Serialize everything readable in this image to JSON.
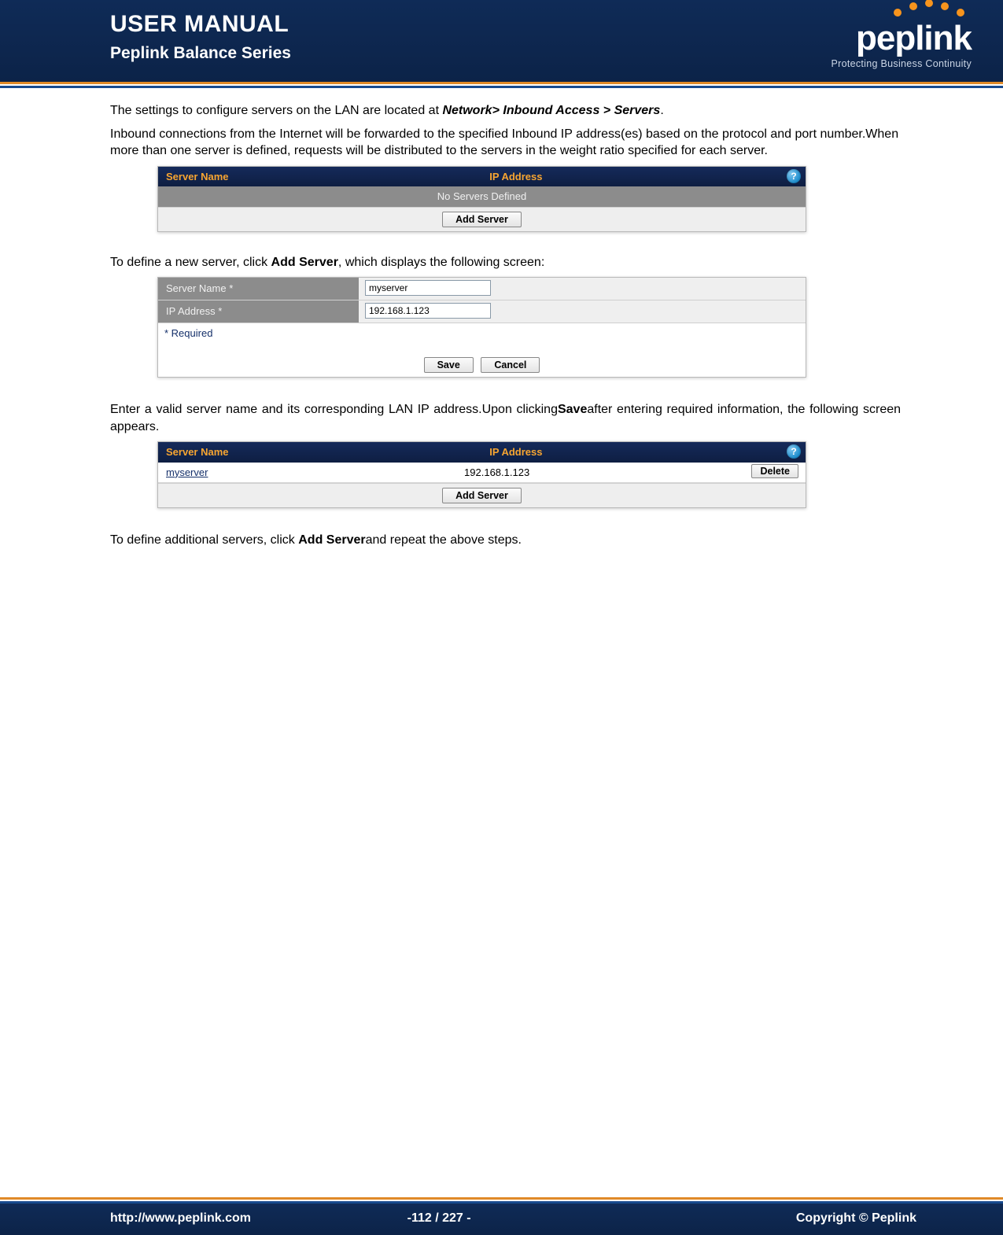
{
  "header": {
    "title": "USER MANUAL",
    "subtitle": "Peplink Balance Series",
    "logo_name": "peplink",
    "logo_tag": "Protecting Business Continuity"
  },
  "body": {
    "p1_pre": "The settings to configure servers on the LAN are located at ",
    "p1_path": "Network> Inbound Access > Servers",
    "p1_post": ".",
    "p2": "Inbound connections from the Internet will be forwarded to the specified Inbound IP address(es) based on the protocol and port number.When more than one server is defined, requests will be distributed to the servers in the weight ratio specified for each server.",
    "p3_pre": "To define a new server, click ",
    "p3_bold": "Add Server",
    "p3_post": ", which displays the following screen:",
    "p4_a": "Enter a valid server name and its corresponding LAN IP address.Upon clicking",
    "p4_b": "Save",
    "p4_c": "after entering required information, the following screen appears.",
    "p5_pre": "To define additional servers, click ",
    "p5_bold": "Add Server",
    "p5_post": "and repeat the above steps."
  },
  "ui1": {
    "col_server": "Server Name",
    "col_ip": "IP Address",
    "empty": "No Servers Defined",
    "add": "Add Server"
  },
  "ui2": {
    "label_name": "Server Name *",
    "label_ip": "IP Address *",
    "val_name": "myserver",
    "val_ip": "192.168.1.123",
    "required": "* Required",
    "save": "Save",
    "cancel": "Cancel"
  },
  "ui3": {
    "col_server": "Server Name",
    "col_ip": "IP Address",
    "row_name": "myserver",
    "row_ip": "192.168.1.123",
    "delete": "Delete",
    "add": "Add Server"
  },
  "footer": {
    "url": "http://www.peplink.com",
    "page": "-112 / 227 -",
    "copyright": "Copyright ©  Peplink"
  }
}
